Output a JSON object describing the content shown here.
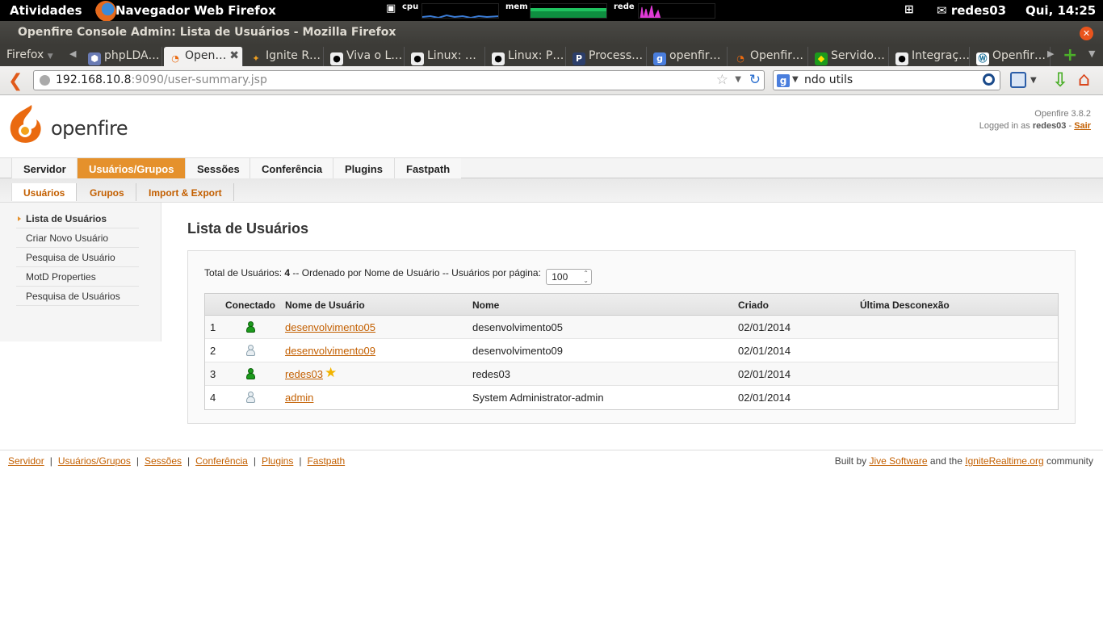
{
  "panel": {
    "activities": "Atividades",
    "app_title": "Navegador Web Firefox",
    "cpu_label": "cpu",
    "mem_label": "mem",
    "net_label": "rede",
    "user": "redes03",
    "clock": "Qui, 14:25"
  },
  "window": {
    "title": "Openfire Console Admin: Lista de Usuários - Mozilla Firefox"
  },
  "tabs": {
    "firefox_menu": "Firefox",
    "items": [
      {
        "label": "phpLDA…",
        "icon": "php-icon"
      },
      {
        "label": "Open…",
        "icon": "openfire-icon"
      },
      {
        "label": "Ignite R…",
        "icon": "ignite-icon"
      },
      {
        "label": "Viva o L…",
        "icon": "tux-icon"
      },
      {
        "label": "Linux: …",
        "icon": "tux-icon"
      },
      {
        "label": "Linux: P…",
        "icon": "tux-icon"
      },
      {
        "label": "Process…",
        "icon": "p-icon"
      },
      {
        "label": "openfir…",
        "icon": "google-icon"
      },
      {
        "label": "Openfir…",
        "icon": "openfire-icon"
      },
      {
        "label": "Servido…",
        "icon": "brazil-flag-icon"
      },
      {
        "label": "Integraç…",
        "icon": "tux-icon"
      },
      {
        "label": "Openfir…",
        "icon": "wordpress-icon"
      }
    ]
  },
  "navbar": {
    "url_host": "192.168.10.8",
    "url_rest": ":9090/user-summary.jsp",
    "search_value": "ndo utils"
  },
  "header": {
    "logo_text": "openfire",
    "version": "Openfire 3.8.2",
    "logged_in_prefix": "Logged in as",
    "logged_user": "redes03",
    "logout": "Sair"
  },
  "main_nav": [
    "Servidor",
    "Usuários/Grupos",
    "Sessões",
    "Conferência",
    "Plugins",
    "Fastpath"
  ],
  "sub_nav": [
    "Usuários",
    "Grupos",
    "Import & Export"
  ],
  "sidebar": [
    "Lista de Usuários",
    "Criar Novo Usuário",
    "Pesquisa de Usuário",
    "MotD Properties",
    "Pesquisa de Usuários"
  ],
  "content": {
    "title": "Lista de Usuários",
    "summary_prefix": "Total de Usuários:",
    "total": "4",
    "summary_middle": "-- Ordenado por Nome de Usuário -- Usuários por página:",
    "per_page": "100"
  },
  "table": {
    "headers": [
      "Conectado",
      "Nome de Usuário",
      "Nome",
      "Criado",
      "Última Desconexão"
    ],
    "rows": [
      {
        "num": "1",
        "online": true,
        "username": "desenvolvimento05",
        "name": "desenvolvimento05",
        "created": "02/01/2014",
        "last": ""
      },
      {
        "num": "2",
        "online": false,
        "username": "desenvolvimento09",
        "name": "desenvolvimento09",
        "created": "02/01/2014",
        "last": ""
      },
      {
        "num": "3",
        "online": true,
        "username": "redes03",
        "name": "redes03",
        "created": "02/01/2014",
        "last": "",
        "admin": true
      },
      {
        "num": "4",
        "online": false,
        "username": "admin",
        "name": "System Administrator-admin",
        "created": "02/01/2014",
        "last": ""
      }
    ]
  },
  "footer": {
    "links": [
      "Servidor",
      "Usuários/Grupos",
      "Sessões",
      "Conferência",
      "Plugins",
      "Fastpath"
    ],
    "built_by": "Built by",
    "jive": "Jive Software",
    "and_the": "and the",
    "ignite": "IgniteRealtime.org",
    "community": "community"
  },
  "colors": {
    "accent": "#e5912c",
    "link": "#c35f00"
  }
}
